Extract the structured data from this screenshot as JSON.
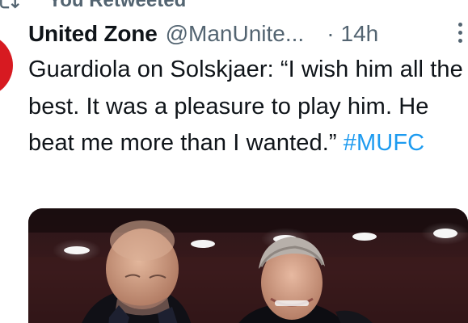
{
  "retweet_context": {
    "icon": "retweet-icon",
    "label": "You Retweeted"
  },
  "tweet": {
    "author": {
      "avatar_color": "#d71a21",
      "display_name": "United Zone",
      "handle": "@ManUnite...",
      "separator": "·",
      "timestamp": "14h"
    },
    "more_icon": "more-vertical-icon",
    "text_main": "Guardiola on Solskjaer: “I wish him all the best. It was a pleasure to play him. He beat me more than I wanted.”",
    "hashtag": "#MUFC",
    "colors": {
      "text": "#0f1419",
      "secondary": "#536471",
      "link": "#1d9bf0"
    }
  }
}
